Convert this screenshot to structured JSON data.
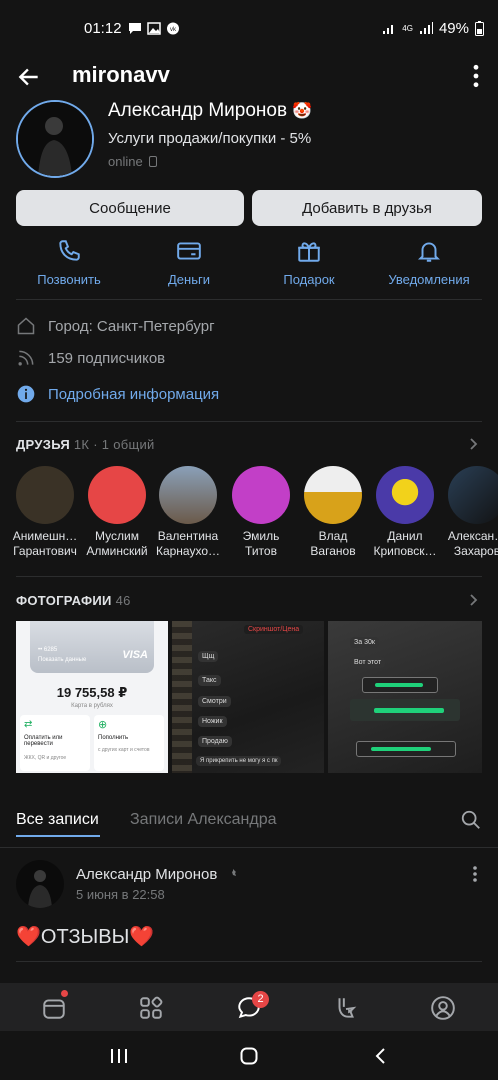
{
  "status_bar": {
    "time": "01:12",
    "battery": "49%",
    "network": "4G"
  },
  "header": {
    "username": "mironavv"
  },
  "profile": {
    "name": "Александр Миронов",
    "name_emoji": "🤡",
    "status": "Услуги продажи/покупки - 5%",
    "online": "online",
    "buttons": {
      "message": "Сообщение",
      "add_friend": "Добавить в друзья"
    },
    "actions": [
      {
        "label": "Позвонить",
        "icon": "phone-icon"
      },
      {
        "label": "Деньги",
        "icon": "money-icon"
      },
      {
        "label": "Подарок",
        "icon": "gift-icon"
      },
      {
        "label": "Уведомления",
        "icon": "bell-icon"
      }
    ],
    "city": "Город: Санкт-Петербург",
    "followers": "159 подписчиков",
    "more_info": "Подробная информация"
  },
  "friends": {
    "title": "ДРУЗЬЯ",
    "count": "1К · 1 общий",
    "items": [
      {
        "line1": "Анимешн…",
        "line2": "Гарантович",
        "color": "#3a3226"
      },
      {
        "line1": "Муслим",
        "line2": "Алминский",
        "color": "#e64646"
      },
      {
        "line1": "Валентина",
        "line2": "Карнаухо…",
        "color": "#6b5a4a"
      },
      {
        "line1": "Эмиль",
        "line2": "Титов",
        "color": "#c23fc7"
      },
      {
        "line1": "Влад",
        "line2": "Ваганов",
        "color": "#d8a21a"
      },
      {
        "line1": "Данил",
        "line2": "Криповск…",
        "color": "#4a3aa8"
      },
      {
        "line1": "Алексан…",
        "line2": "Захаров",
        "color": "#2a3f55"
      }
    ]
  },
  "photos": {
    "title": "ФОТОГРАФИИ",
    "count": "46",
    "card": {
      "card_number": "•• 6285",
      "show_data": "Показать данные",
      "brand": "VISA",
      "balance": "19 755,58 ₽",
      "balance_caption": "Карта в рублях",
      "op1_title": "Оплатить или перевести",
      "op1_sub": "ЖКХ, QR и другое",
      "op2_title": "Пополнить",
      "op2_sub": "с других карт и счетов"
    },
    "chat1": {
      "header": "Скриншот/Цена",
      "messages": [
        "Щщ",
        "Такс",
        "Смотри",
        "Ножик",
        "Продаю"
      ],
      "bottom": "Я прикрепить не могу я с пк"
    },
    "chat2": {
      "header": "За 30к",
      "message": "Вот этот"
    }
  },
  "wall": {
    "tab_all": "Все записи",
    "tab_user": "Записи Александра",
    "post": {
      "author": "Александр Миронов",
      "date": "5 июня в 22:58",
      "text": "❤️ОТЗЫВЫ❤️"
    }
  },
  "bottom_nav": {
    "messages_badge": "2"
  },
  "colors": {
    "accent": "#71aaeb",
    "background": "#141414",
    "badge": "#e64646"
  }
}
